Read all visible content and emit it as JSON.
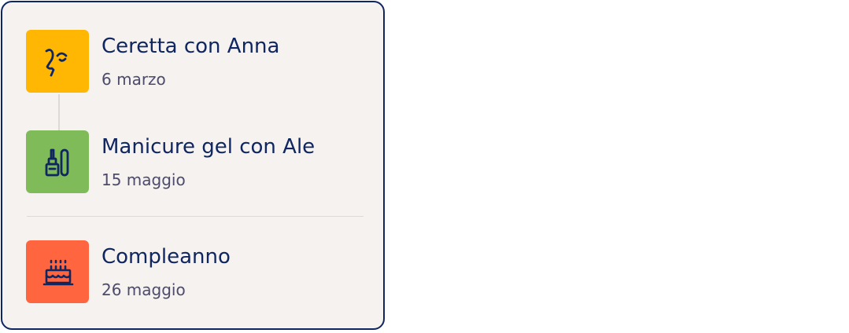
{
  "events": [
    {
      "title": "Ceretta con Anna",
      "date": "6 marzo",
      "icon": "face-icon",
      "color": "#ffb703"
    },
    {
      "title": "Manicure gel con Ale",
      "date": "15 maggio",
      "icon": "nail-polish-icon",
      "color": "#80bb59"
    },
    {
      "title": "Compleanno",
      "date": "26 maggio",
      "icon": "birthday-cake-icon",
      "color": "#ff6640"
    }
  ],
  "colors": {
    "ink": "#102660",
    "muted": "#4d4a6b",
    "card_bg": "#f5f2f0",
    "divider": "#dcd9d6"
  }
}
